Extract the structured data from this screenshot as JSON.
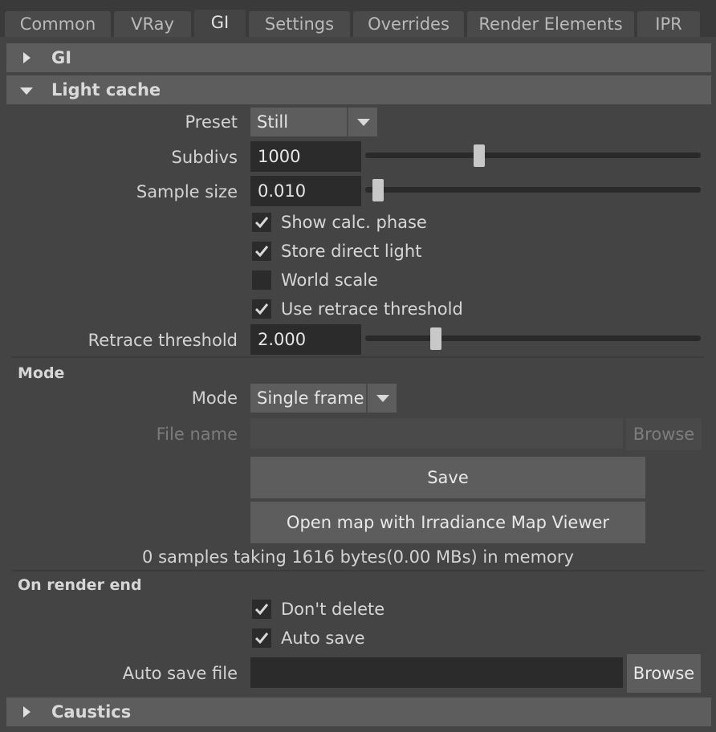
{
  "tabs": [
    "Common",
    "VRay",
    "GI",
    "Settings",
    "Overrides",
    "Render Elements",
    "IPR"
  ],
  "active_tab": "GI",
  "frames": {
    "gi": {
      "title": "GI",
      "expanded": false
    },
    "light_cache": {
      "title": "Light cache",
      "expanded": true
    },
    "caustics": {
      "title": "Caustics",
      "expanded": false
    }
  },
  "light_cache": {
    "preset": {
      "label": "Preset",
      "value": "Still"
    },
    "subdivs": {
      "label": "Subdivs",
      "value": "1000",
      "slider_fraction": 0.34
    },
    "sample_size": {
      "label": "Sample size",
      "value": "0.010",
      "slider_fraction": 0.01
    },
    "checkboxes": [
      {
        "label": "Show calc. phase",
        "checked": true
      },
      {
        "label": "Store direct light",
        "checked": true
      },
      {
        "label": "World scale",
        "checked": false
      },
      {
        "label": "Use retrace threshold",
        "checked": true
      }
    ],
    "retrace_threshold": {
      "label": "Retrace threshold",
      "value": "2.000",
      "slider_fraction": 0.2
    }
  },
  "mode_section": {
    "title": "Mode",
    "mode": {
      "label": "Mode",
      "value": "Single frame"
    },
    "file_name": {
      "label": "File name",
      "value": "",
      "browse": "Browse"
    },
    "save_button": "Save",
    "open_map_button": "Open map with Irradiance Map Viewer",
    "info": "0 samples taking 1616 bytes(0.00 MBs) in memory"
  },
  "render_end_section": {
    "title": "On render end",
    "checkboxes": [
      {
        "label": "Don't delete",
        "checked": true
      },
      {
        "label": "Auto save",
        "checked": true
      }
    ],
    "auto_save_file": {
      "label": "Auto save file",
      "value": "",
      "browse": "Browse"
    }
  }
}
